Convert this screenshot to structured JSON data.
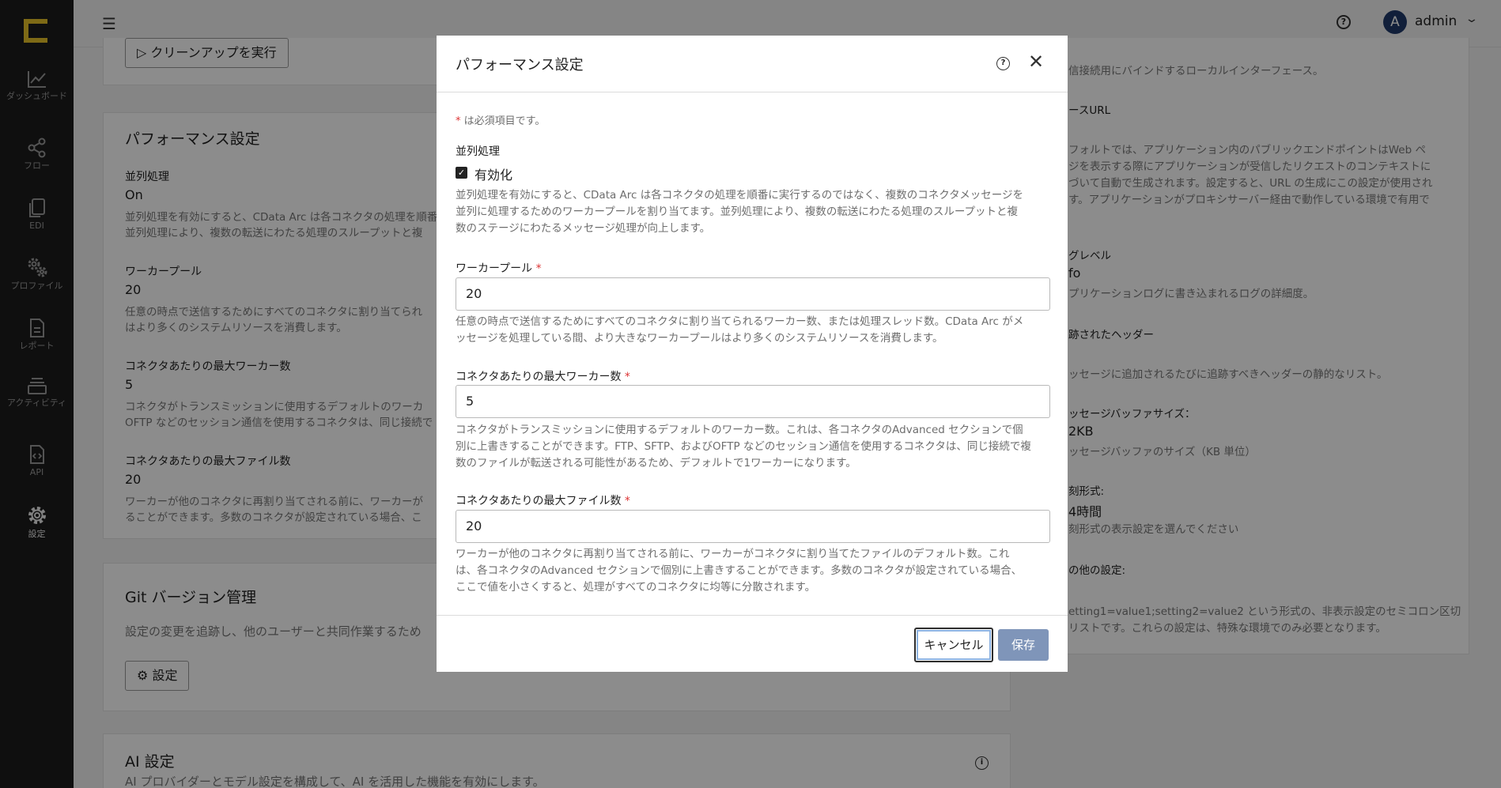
{
  "sidebar": {
    "items": [
      {
        "label": "ダッシュボード",
        "icon": "chart-line-icon"
      },
      {
        "label": "フロー",
        "icon": "share-nodes-icon"
      },
      {
        "label": "EDI",
        "icon": "documents-icon"
      },
      {
        "label": "プロファイル",
        "icon": "gears-icon"
      },
      {
        "label": "レポート",
        "icon": "report-icon"
      },
      {
        "label": "アクティビティ",
        "icon": "stack-icon"
      },
      {
        "label": "API",
        "icon": "api-file-icon"
      },
      {
        "label": "設定",
        "icon": "gear-icon"
      }
    ]
  },
  "topbar": {
    "user_initial": "A",
    "user_name": "admin"
  },
  "background": {
    "cleanup_button": "クリーンアップを実行",
    "perf_card": {
      "title": "パフォーマンス設定",
      "parallel_label": "並列処理",
      "parallel_value": "On",
      "parallel_desc_1": "並列処理を有効にすると、CData Arc は各コネクタの処理を順番に",
      "parallel_desc_2": "並列処理により、複数の転送にわたる処理のスループットと複",
      "pool_label": "ワーカープール",
      "pool_value": "20",
      "pool_desc_1": "任意の時点で送信するためにすべてのコネクタに割り当てられ",
      "pool_desc_2": "はより多くのシステムリソースを消費します。",
      "maxw_label": "コネクタあたりの最大ワーカー数",
      "maxw_value": "5",
      "maxw_desc_1": "コネクタがトランスミッションに使用するデフォルトのワーカ",
      "maxw_desc_2": "OFTP などのセッション通信を使用するコネクタは、同じ接続で",
      "maxf_label": "コネクタあたりの最大ファイル数",
      "maxf_value": "20",
      "maxf_desc_1": "ワーカーが他のコネクタに再割り当てされる前に、ワーカーが",
      "maxf_desc_2": "ることができます。多数のコネクタが設定されている場合、こ"
    },
    "git_card": {
      "title": "Git バージョン管理",
      "desc": "設定の変更を追跡し、他のユーザーと共同作業するため",
      "settings_button": "設定"
    },
    "ai_card": {
      "title": "AI 設定",
      "desc": "AI プロバイダーとモデル設定を構成して、AI を活用した機能を有効にします。"
    },
    "right_card": {
      "line_1": "信接続用にバインドするローカルインターフェース。",
      "base_url_label": "ースURL",
      "base_desc_1": "フォルトでは、アプリケーション内のパブリックエンドポイントはWeb ペ",
      "base_desc_2": "ジを表示する際にアプリケーションが受信したリクエストのコンテキストに",
      "base_desc_3": "づいて自動で生成されます。設定すると、URL の生成にこの設定が使用され",
      "base_desc_4": "す。アプリケーションがプロキシサーバー経由で動作している環境で有用で",
      "log_label": "グレベル",
      "log_value": "fo",
      "log_desc": "プリケーションログに書き込まれるログの詳細度。",
      "headers_label": "跡されたヘッダー",
      "headers_desc": "ッセージに追加されるたびに追跡すべきヘッダーの静的なリスト。",
      "buffer_label": "ッセージバッファサイズ：",
      "buffer_value": "2KB",
      "buffer_desc": "ッセージバッファのサイズ（KB 単位）",
      "time_label": "刻形式:",
      "time_value": "4時間",
      "time_desc": "刻形式の表示設定を選んでください",
      "other_label": "の他の設定:",
      "other_desc_1": "etting1=value1;setting2=value2 という形式の、非表示設定のセミコロン区切",
      "other_desc_2": "リストです。これらの設定は、特殊な環境でのみ必要となります。"
    }
  },
  "modal": {
    "title": "パフォーマンス設定",
    "required_star": "*",
    "required_note": " は必須項目です。",
    "parallel_label": "並列処理",
    "enable_label": "有効化",
    "enable_checked": true,
    "parallel_desc_1": "並列処理を有効にすると、CData Arc は各コネクタの処理を順番に実行するのではなく、複数のコネクタメッセージを",
    "parallel_desc_2": "並列に処理するためのワーカープールを割り当てます。並列処理により、複数の転送にわたる処理のスループットと複",
    "parallel_desc_3": "数のステージにわたるメッセージ処理が向上します。",
    "pool_label": "ワーカープール",
    "pool_value": "20",
    "pool_desc_1": "任意の時点で送信するためにすべてのコネクタに割り当てられるワーカー数、または処理スレッド数。CData Arc がメ",
    "pool_desc_2": "ッセージを処理している間、より大きなワーカープールはより多くのシステムリソースを消費します。",
    "maxw_label": "コネクタあたりの最大ワーカー数",
    "maxw_value": "5",
    "maxw_desc_1": "コネクタがトランスミッションに使用するデフォルトのワーカー数。これは、各コネクタのAdvanced セクションで個",
    "maxw_desc_2": "別に上書きすることができます。FTP、SFTP、およびOFTP などのセッション通信を使用するコネクタは、同じ接続で複",
    "maxw_desc_3": "数のファイルが転送される可能性があるため、デフォルトで1ワーカーになります。",
    "maxf_label": "コネクタあたりの最大ファイル数",
    "maxf_value": "20",
    "maxf_desc_1": "ワーカーが他のコネクタに再割り当てされる前に、ワーカーがコネクタに割り当てたファイルのデフォルト数。これ",
    "maxf_desc_2": "は、各コネクタのAdvanced セクションで個別に上書きすることができます。多数のコネクタが設定されている場合、",
    "maxf_desc_3": "ここで値を小さくすると、処理がすべてのコネクタに均等に分散されます。",
    "cancel_label": "キャンセル",
    "save_label": "保存"
  }
}
